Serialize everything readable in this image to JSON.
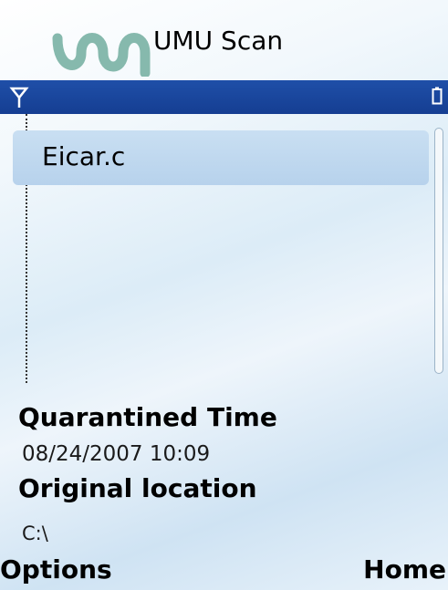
{
  "app": {
    "title": "UMU Scan",
    "logo_icon": "umu-wave-logo-icon"
  },
  "status_bar": {
    "signal_icon": "antenna-signal-icon",
    "battery_icon": "battery-icon",
    "color": "#1a45a0"
  },
  "list": {
    "items": [
      {
        "label": "Eicar.c",
        "selected": true
      }
    ]
  },
  "details": {
    "quarantined_time_label": "Quarantined Time",
    "quarantined_time_value": "08/24/2007 10:09",
    "original_location_label": "Original location",
    "original_location_value": "C:\\"
  },
  "softkeys": {
    "left": "Options",
    "right": "Home"
  },
  "colors": {
    "logo": "#86b9ad",
    "highlight": "#c2daf0"
  }
}
